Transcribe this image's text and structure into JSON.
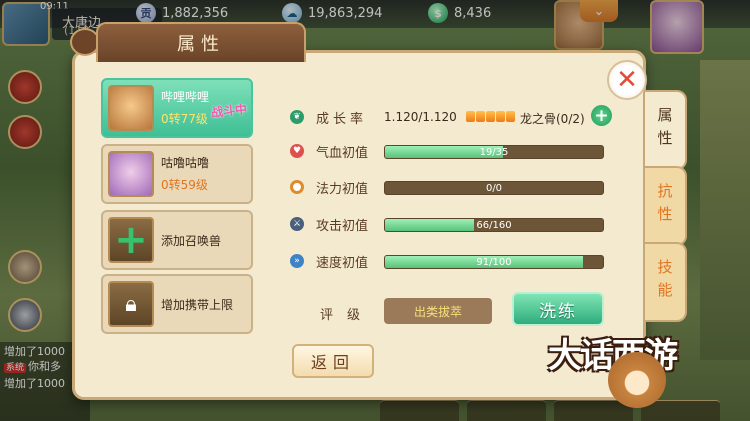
{
  "topbar": {
    "time": "09:11",
    "map_name": "大唐边",
    "map_coord": "(110",
    "silver": "1,882,356",
    "silver_icon": "silver-coin-icon",
    "gold": "19,863,294",
    "gold_icon": "cloud-coin-icon",
    "jade": "8,436",
    "jade_icon": "jade-icon",
    "collapse_icon": "chevron-down-icon"
  },
  "chat": {
    "lines": [
      {
        "tag": "",
        "text": "增加了1000"
      },
      {
        "tag": "系统",
        "text": "你和多"
      },
      {
        "tag": "",
        "text": "增加了1000"
      }
    ]
  },
  "modal": {
    "title": "属性",
    "close_icon": "close-icon"
  },
  "pets": [
    {
      "name": "哔哩哔哩",
      "level": "0转77级",
      "badge": "战斗中",
      "active": true
    },
    {
      "name": "咕噜咕噜",
      "level": "0转59级",
      "active": false
    }
  ],
  "actions": {
    "add_summon": "添加召唤兽",
    "increase_limit": "增加携带上限"
  },
  "attributes": {
    "growth": {
      "label": "成长率",
      "value": "1.120/1.120",
      "bone_label": "龙之骨(0/2)"
    },
    "hp": {
      "label": "气血初值",
      "text": "19/35",
      "fraction": 0.54
    },
    "mp": {
      "label": "法力初值",
      "text": "0/0",
      "fraction": 0
    },
    "atk": {
      "label": "攻击初值",
      "text": "66/160",
      "fraction": 0.41
    },
    "spd": {
      "label": "速度初值",
      "text": "91/100",
      "fraction": 0.91
    }
  },
  "grade": {
    "label": "评级",
    "value": "出类拔萃"
  },
  "buttons": {
    "wash": "洗练",
    "back": "返回"
  },
  "tabs": [
    "属性",
    "抗性",
    "技能"
  ],
  "logo": {
    "text": "大话西游"
  },
  "colors": {
    "accent_green": "#3fbf95",
    "bar_fill": "#57c279",
    "panel_bg": "#f4ead0",
    "title_brown": "#6a4428"
  }
}
